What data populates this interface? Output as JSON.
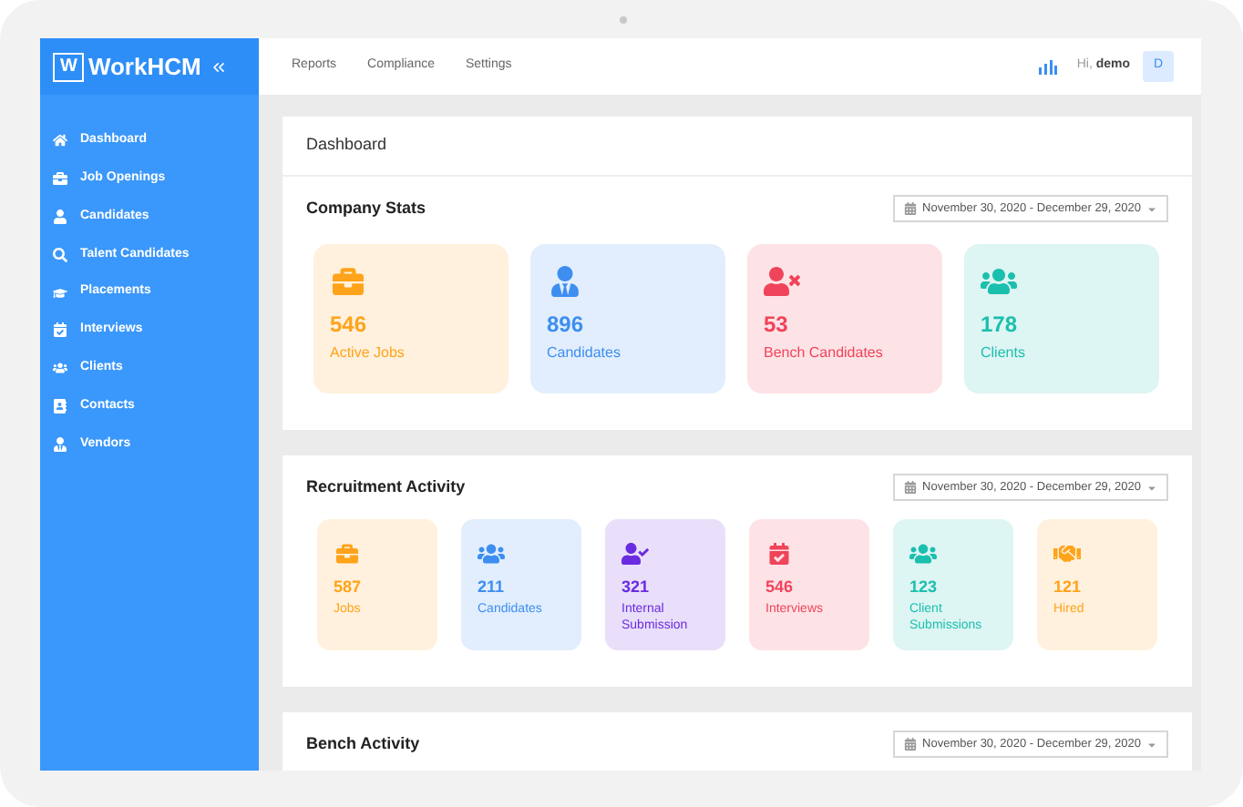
{
  "app": {
    "logo_mark": "W",
    "logo_text": "WorkHCM"
  },
  "sidebar": {
    "items": [
      {
        "label": "Dashboard"
      },
      {
        "label": "Job Openings"
      },
      {
        "label": "Candidates"
      },
      {
        "label": "Talent Candidates"
      },
      {
        "label": "Placements"
      },
      {
        "label": "Interviews"
      },
      {
        "label": "Clients"
      },
      {
        "label": "Contacts"
      },
      {
        "label": "Vendors"
      }
    ]
  },
  "top_nav": {
    "links": [
      "Reports",
      "Compliance",
      "Settings"
    ],
    "greeting": "Hi, **demo**",
    "avatar": "D"
  },
  "page_title": "Dashboard",
  "sections": [
    {
      "title": "Company Stats",
      "date_range": "November 30, 2020 - December 29, 2020",
      "cards": [
        {
          "value": "546",
          "label": "Active Jobs",
          "color": "#ffa31a"
        },
        {
          "value": "896",
          "label": "Candidates",
          "color": "#3d8ef0"
        },
        {
          "value": "53",
          "label": "Bench Candidates",
          "color": "#f0445a"
        },
        {
          "value": "178",
          "label": "Clients",
          "color": "#1bbfae"
        }
      ]
    },
    {
      "title": "Recruitment Activity",
      "date_range": "November 30, 2020 - December 29, 2020",
      "cards": [
        {
          "value": "587",
          "label": "Jobs",
          "color": "#ffa31a"
        },
        {
          "value": "211",
          "label": "Candidates",
          "color": "#3d8ef0"
        },
        {
          "value": "321",
          "label": "Internal Submission",
          "color": "#6a2ce0"
        },
        {
          "value": "546",
          "label": "Interviews",
          "color": "#f0445a"
        },
        {
          "value": "123",
          "label": "Client Submissions",
          "color": "#1bbfae"
        },
        {
          "value": "121",
          "label": "Hired",
          "color": "#ffa31a"
        }
      ]
    },
    {
      "title": "Bench Activity",
      "date_range": "November 30, 2020 - December 29, 2020"
    }
  ]
}
